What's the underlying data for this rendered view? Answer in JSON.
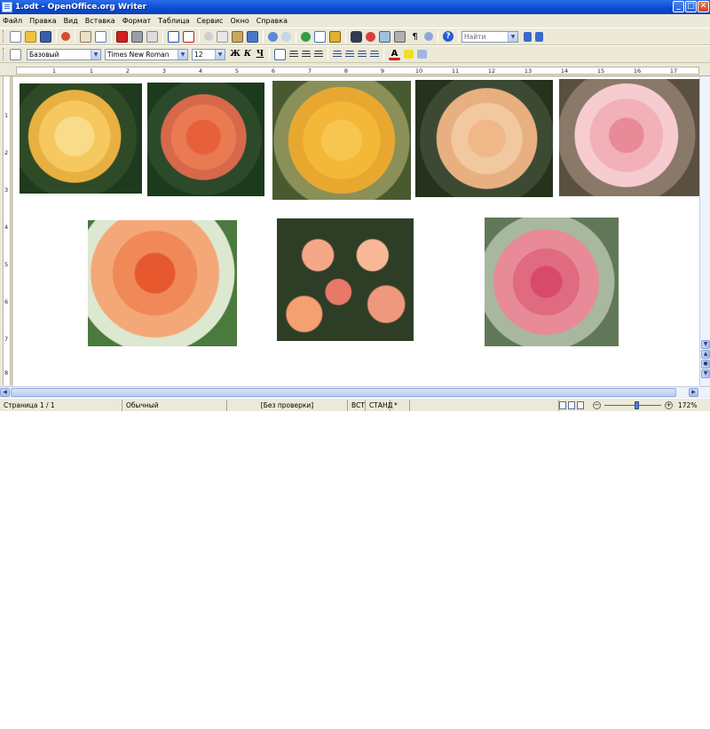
{
  "window": {
    "title": "1.odt - OpenOffice.org Writer",
    "minimize": "_",
    "maximize": "□",
    "close": "✕"
  },
  "menu": [
    {
      "key": "file",
      "label": "Файл"
    },
    {
      "key": "edit",
      "label": "Правка"
    },
    {
      "key": "view",
      "label": "Вид"
    },
    {
      "key": "insert",
      "label": "Вставка"
    },
    {
      "key": "format",
      "label": "Формат"
    },
    {
      "key": "table",
      "label": "Таблица"
    },
    {
      "key": "tools",
      "label": "Сервис"
    },
    {
      "key": "window",
      "label": "Окно"
    },
    {
      "key": "help",
      "label": "Справка"
    }
  ],
  "toolbar": {
    "find_placeholder": "Найти"
  },
  "formatting": {
    "style": "Базовый",
    "font": "Times New Roman",
    "size": "12",
    "bold": "Ж",
    "italic": "К",
    "underline": "Ч"
  },
  "ruler": {
    "h_labels": [
      "1",
      "1",
      "2",
      "3",
      "4",
      "5",
      "6",
      "7",
      "8",
      "9",
      "10",
      "11",
      "12",
      "13",
      "14",
      "15",
      "16",
      "17",
      "18"
    ],
    "v_labels": [
      "1",
      "2",
      "3",
      "4",
      "5",
      "6",
      "7",
      "8"
    ]
  },
  "status": {
    "page": "Страница  1 / 1",
    "page_style": "Обычный",
    "language": "[Без проверки]",
    "insert_mode": "ВСТ",
    "selection_mode": "СТАНД",
    "modified": "*",
    "zoom": "172%",
    "zoom_level": 172
  },
  "colors": {
    "titlebar": "#0a4bd4",
    "chrome": "#ece9d8",
    "page": "#ffffff"
  }
}
